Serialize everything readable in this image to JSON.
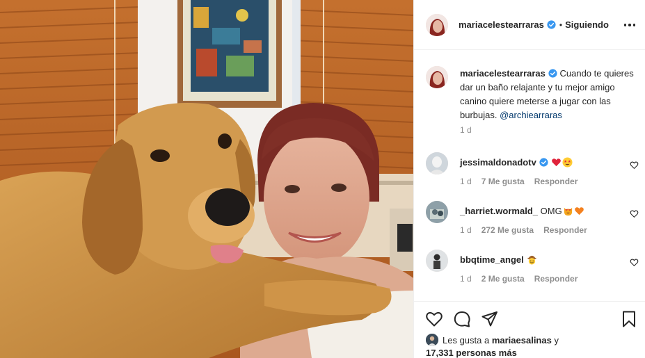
{
  "post": {
    "photo_alt": ""
  },
  "header": {
    "username": "mariacelestearraras",
    "separator": "•",
    "follow_state": "Siguiendo"
  },
  "caption": {
    "username": "mariacelestearraras",
    "text": " Cuando te quieres dar un baño relajante y tu mejor amigo canino quiere meterse a jugar con las burbujas. ",
    "mention": "@archiearraras",
    "time": "1 d"
  },
  "comments": [
    {
      "username": "jessimaldonadotv",
      "text": "",
      "verified": true,
      "emojis": [
        "red-heart",
        "star-struck"
      ],
      "time": "1 d",
      "likes": "7 Me gusta",
      "reply": "Responder"
    },
    {
      "username": "_harriet.wormald_",
      "text": "OMG",
      "verified": false,
      "emojis": [
        "heart-eyes-cat",
        "orange-heart"
      ],
      "time": "1 d",
      "likes": "272 Me gusta",
      "reply": "Responder"
    },
    {
      "username": "bbqtime_angel",
      "text": "",
      "verified": false,
      "emojis": [
        "cowboy-face"
      ],
      "time": "1 d",
      "likes": "2 Me gusta",
      "reply": "Responder"
    }
  ],
  "footer": {
    "likes_prefix": "Les gusta a ",
    "liked_by": "mariaesalinas",
    "likes_mid": " y",
    "likes_count": "17,331 personas más"
  },
  "colors": {
    "verified": "#3897f0",
    "link": "#00376b",
    "meta": "#8e8e8e",
    "text": "#262626"
  }
}
